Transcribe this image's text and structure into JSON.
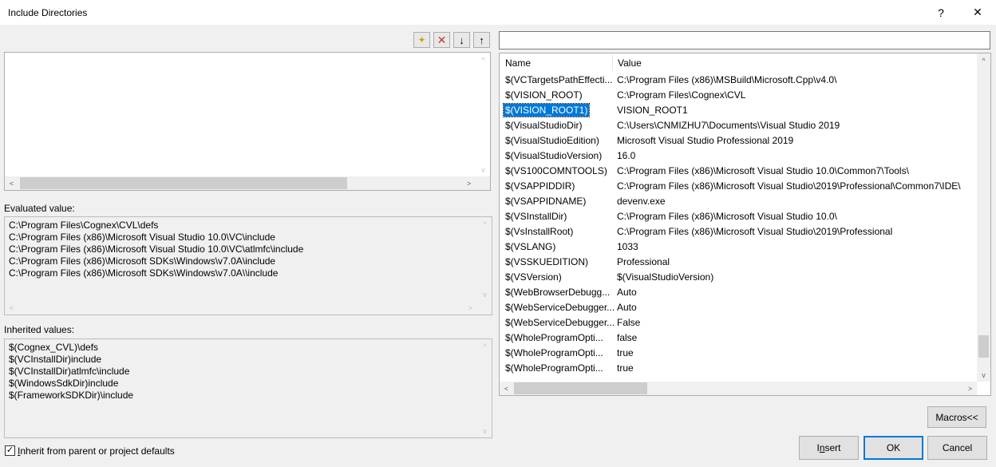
{
  "window": {
    "title": "Include Directories",
    "help_label": "?",
    "close_label": "✕"
  },
  "left": {
    "evaluated_label": "Evaluated value:",
    "evaluated_lines": "C:\\Program Files\\Cognex\\CVL\\defs\nC:\\Program Files (x86)\\Microsoft Visual Studio 10.0\\VC\\include\nC:\\Program Files (x86)\\Microsoft Visual Studio 10.0\\VC\\atlmfc\\include\nC:\\Program Files (x86)\\Microsoft SDKs\\Windows\\v7.0A\\include\nC:\\Program Files (x86)\\Microsoft SDKs\\Windows\\v7.0A\\\\include",
    "inherited_label": "Inherited values:",
    "inherited_lines": "$(Cognex_CVL)\\defs\n$(VCInstallDir)include\n$(VCInstallDir)atlmfc\\include\n$(WindowsSdkDir)include\n$(FrameworkSDKDir)\\include",
    "inherit_checkbox": {
      "label_accel": "I",
      "label_rest": "nherit from parent or project defaults",
      "checked": true,
      "check_glyph": "✓"
    }
  },
  "toolbar": {
    "icons": [
      "new-line-icon",
      "delete-icon",
      "move-down-icon",
      "move-up-icon"
    ],
    "glyphs": {
      "new_line": "✦",
      "delete": "✕",
      "down": "↓",
      "up": "↑"
    },
    "colors": {
      "delete": "#c0392b",
      "new_line": "#d4a017"
    }
  },
  "macros": {
    "filter_value": "",
    "headers": {
      "name": "Name",
      "value": "Value"
    },
    "selected_index": 2,
    "rows": [
      {
        "name": "$(VCTargetsPathEffecti...",
        "value": "C:\\Program Files (x86)\\MSBuild\\Microsoft.Cpp\\v4.0\\"
      },
      {
        "name": "$(VISION_ROOT)",
        "value": "C:\\Program Files\\Cognex\\CVL"
      },
      {
        "name": "$(VISION_ROOT1)",
        "value": "VISION_ROOT1"
      },
      {
        "name": "$(VisualStudioDir)",
        "value": "C:\\Users\\CNMIZHU7\\Documents\\Visual Studio 2019"
      },
      {
        "name": "$(VisualStudioEdition)",
        "value": "Microsoft Visual Studio Professional 2019"
      },
      {
        "name": "$(VisualStudioVersion)",
        "value": "16.0"
      },
      {
        "name": "$(VS100COMNTOOLS)",
        "value": "C:\\Program Files (x86)\\Microsoft Visual Studio 10.0\\Common7\\Tools\\"
      },
      {
        "name": "$(VSAPPIDDIR)",
        "value": "C:\\Program Files (x86)\\Microsoft Visual Studio\\2019\\Professional\\Common7\\IDE\\"
      },
      {
        "name": "$(VSAPPIDNAME)",
        "value": "devenv.exe"
      },
      {
        "name": "$(VSInstallDir)",
        "value": "C:\\Program Files (x86)\\Microsoft Visual Studio 10.0\\"
      },
      {
        "name": "$(VsInstallRoot)",
        "value": "C:\\Program Files (x86)\\Microsoft Visual Studio\\2019\\Professional"
      },
      {
        "name": "$(VSLANG)",
        "value": "1033"
      },
      {
        "name": "$(VSSKUEDITION)",
        "value": "Professional"
      },
      {
        "name": "$(VSVersion)",
        "value": "$(VisualStudioVersion)"
      },
      {
        "name": "$(WebBrowserDebugg...",
        "value": "Auto"
      },
      {
        "name": "$(WebServiceDebugger...",
        "value": "Auto"
      },
      {
        "name": "$(WebServiceDebugger...",
        "value": "False"
      },
      {
        "name": "$(WholeProgramOpti...",
        "value": "false"
      },
      {
        "name": "$(WholeProgramOpti...",
        "value": "true"
      },
      {
        "name": "$(WholeProgramOpti...",
        "value": "true"
      }
    ]
  },
  "buttons": {
    "macros": "Macros<<",
    "insert_accel": "n",
    "insert_pre": "I",
    "insert_post": "sert",
    "ok": "OK",
    "cancel": "Cancel"
  },
  "scroll_glyphs": {
    "up": "▲",
    "down": "▼",
    "left": "◀",
    "right": "▶",
    "up_caret": "^",
    "down_caret": "v",
    "left_caret": "<",
    "right_caret": ">"
  }
}
